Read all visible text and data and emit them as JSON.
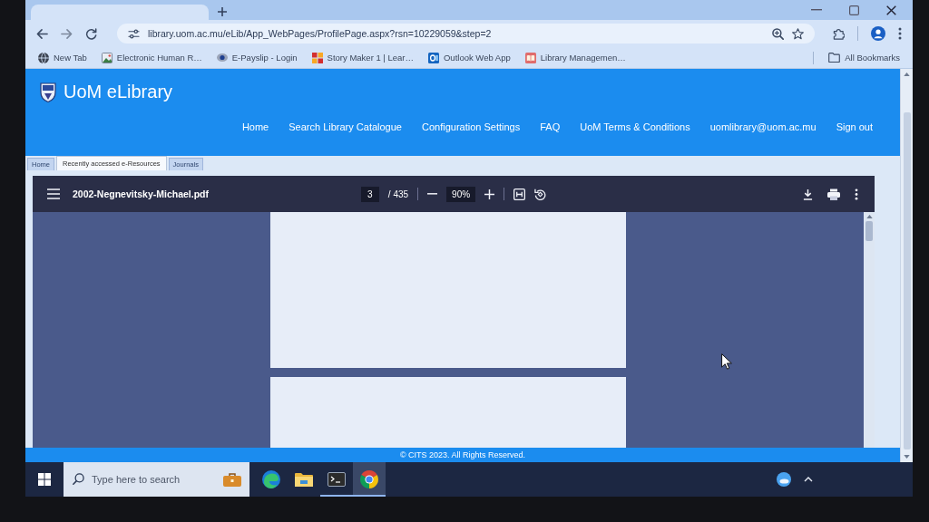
{
  "browser": {
    "url": "library.uom.ac.mu/eLib/App_WebPages/ProfilePage.aspx?rsn=10229059&step=2",
    "bookmarks": [
      {
        "kind": "globe",
        "label": "New Tab"
      },
      {
        "kind": "photo",
        "label": "Electronic Human R…"
      },
      {
        "kind": "eye",
        "label": "E-Payslip - Login"
      },
      {
        "kind": "blocks",
        "label": "Story Maker 1 | Lear…"
      },
      {
        "kind": "tile",
        "label": "Outlook Web App"
      },
      {
        "kind": "book",
        "label": "Library Managemen…"
      }
    ],
    "all_bookmarks": "All Bookmarks"
  },
  "site": {
    "title": "UoM eLibrary",
    "nav": [
      "Home",
      "Search Library Catalogue",
      "Configuration Settings",
      "FAQ",
      "UoM Terms & Conditions",
      "uomlibrary@uom.ac.mu",
      "Sign out"
    ]
  },
  "sub_tabs": [
    {
      "label": "Home",
      "selected": false
    },
    {
      "label": "Recently accessed e-Resources",
      "selected": true
    },
    {
      "label": "Journals",
      "selected": false
    }
  ],
  "pdf_viewer": {
    "filename": "2002-Negnevitsky-Michael.pdf",
    "page": "3",
    "page_total": "/ 435",
    "zoom": "90%"
  },
  "footer": "© CITS 2023. All Rights Reserved.",
  "taskbar": {
    "search": {
      "placeholder": "Type here to search"
    },
    "apps": [
      {
        "kind": "edge",
        "running": false,
        "selected": false
      },
      {
        "kind": "explorer",
        "running": false,
        "selected": false
      },
      {
        "kind": "terminal",
        "running": true,
        "selected": false
      },
      {
        "kind": "chrome",
        "running": true,
        "selected": true
      }
    ]
  }
}
